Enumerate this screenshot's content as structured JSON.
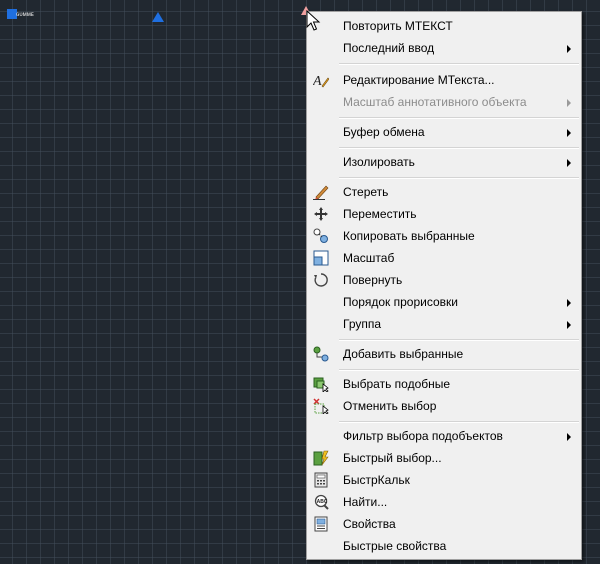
{
  "canvas": {
    "mtext_fragment": "ɢᴜᴍᴍᴇ",
    "grid_color": "#212830"
  },
  "context_menu": {
    "items": [
      {
        "label": "Повторить МТЕКСТ"
      },
      {
        "label": "Последний ввод",
        "submenu": true
      },
      {
        "label": "Редактирование МТекста...",
        "icon": "edit-mtext-icon"
      },
      {
        "label": "Масштаб аннотативного объекта",
        "submenu": true,
        "disabled": true
      },
      {
        "label": "Буфер обмена",
        "submenu": true
      },
      {
        "label": "Изолировать",
        "submenu": true
      },
      {
        "label": "Стереть",
        "icon": "erase-icon"
      },
      {
        "label": "Переместить",
        "icon": "move-icon"
      },
      {
        "label": "Копировать выбранные",
        "icon": "copy-icon"
      },
      {
        "label": "Масштаб",
        "icon": "scale-icon"
      },
      {
        "label": "Повернуть",
        "icon": "rotate-icon"
      },
      {
        "label": "Порядок прорисовки",
        "submenu": true
      },
      {
        "label": "Группа",
        "submenu": true
      },
      {
        "label": "Добавить выбранные",
        "icon": "add-selected-icon"
      },
      {
        "label": "Выбрать подобные",
        "icon": "select-similar-icon"
      },
      {
        "label": "Отменить выбор",
        "icon": "deselect-icon"
      },
      {
        "label": "Фильтр выбора подобъектов",
        "submenu": true
      },
      {
        "label": "Быстрый выбор...",
        "icon": "quick-select-icon"
      },
      {
        "label": "БыстрКальк",
        "icon": "calculator-icon"
      },
      {
        "label": "Найти...",
        "icon": "find-icon"
      },
      {
        "label": "Свойства",
        "icon": "properties-icon"
      },
      {
        "label": "Быстрые свойства"
      }
    ]
  }
}
